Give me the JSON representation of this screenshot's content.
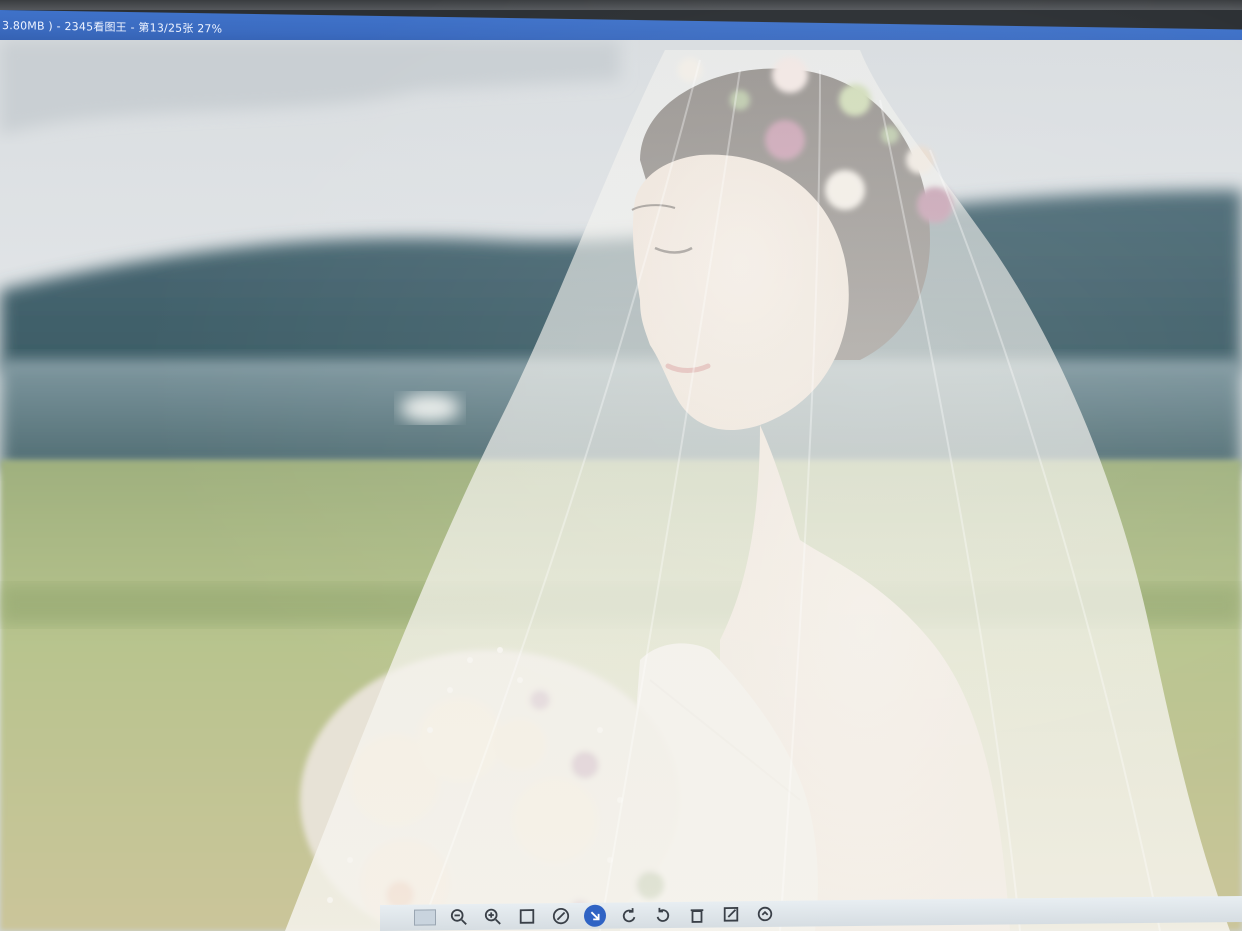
{
  "window": {
    "title": "3.80MB ) - 2345看图王 - 第13/25张 27%"
  },
  "viewer": {
    "image_subject": "bride-with-veil-and-bouquet"
  },
  "toolbar": {
    "buttons": [
      {
        "icon": "thumbnail-icon"
      },
      {
        "icon": "zoom-out-icon"
      },
      {
        "icon": "zoom-in-icon"
      },
      {
        "icon": "fit-window-icon"
      },
      {
        "icon": "compass-icon"
      },
      {
        "icon": "rotate-left-icon"
      },
      {
        "icon": "rotate-right-icon"
      },
      {
        "icon": "delete-icon"
      },
      {
        "icon": "edit-icon"
      },
      {
        "icon": "more-icon"
      }
    ]
  },
  "colors": {
    "titlebar": "#3b6bc0",
    "titlebar_text": "#eef3ff",
    "active_button": "#2f63c4"
  }
}
